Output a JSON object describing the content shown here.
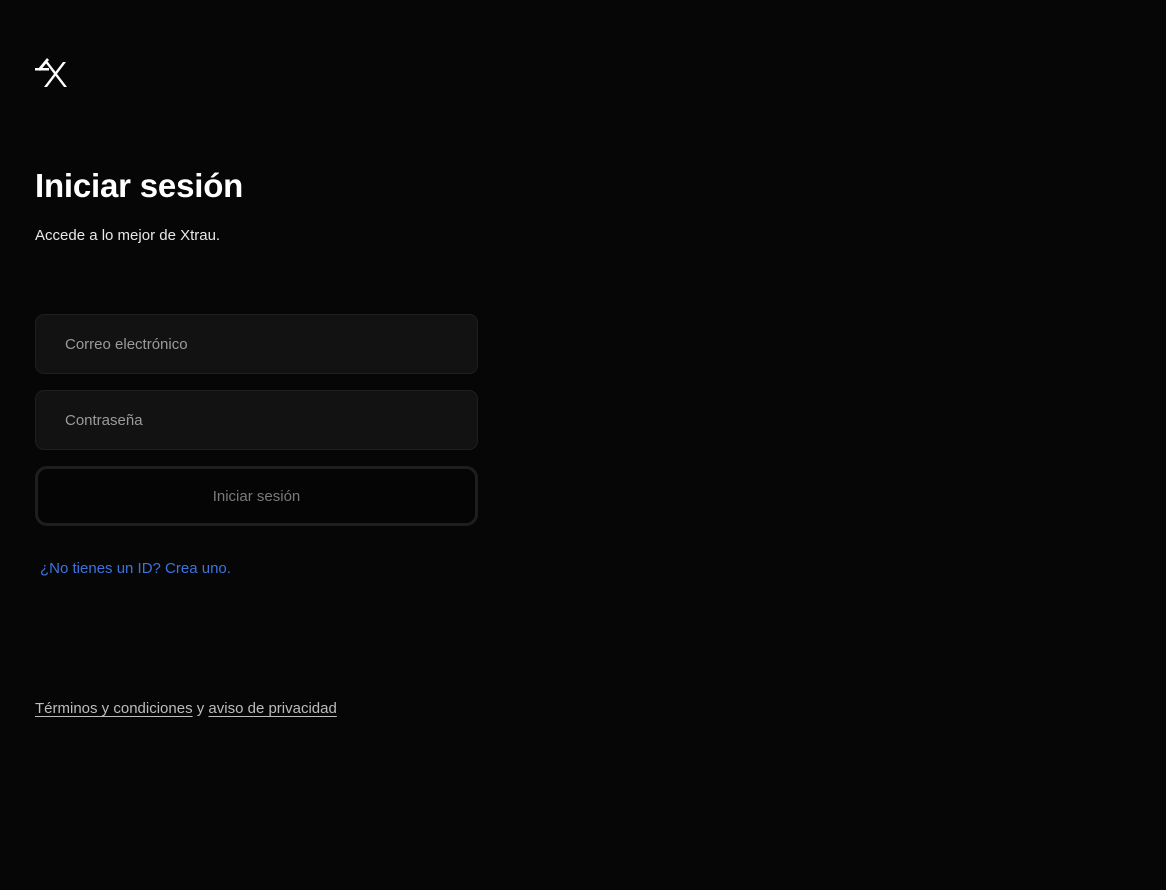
{
  "brand": {
    "logo_icon": "xtrau-logo-icon"
  },
  "login": {
    "title": "Iniciar sesión",
    "subtitle": "Accede a lo mejor de Xtrau.",
    "email_placeholder": "Correo electrónico",
    "email_value": "",
    "password_placeholder": "Contraseña",
    "password_value": "",
    "submit_label": "Iniciar sesión",
    "signup_link": "¿No tienes un ID? Crea uno."
  },
  "footer": {
    "terms_link": "Términos y condiciones",
    "connector": "y",
    "privacy_link": "aviso de privacidad"
  },
  "colors": {
    "background": "#060606",
    "link_blue": "#3b74e0",
    "field_bg": "#121212"
  }
}
